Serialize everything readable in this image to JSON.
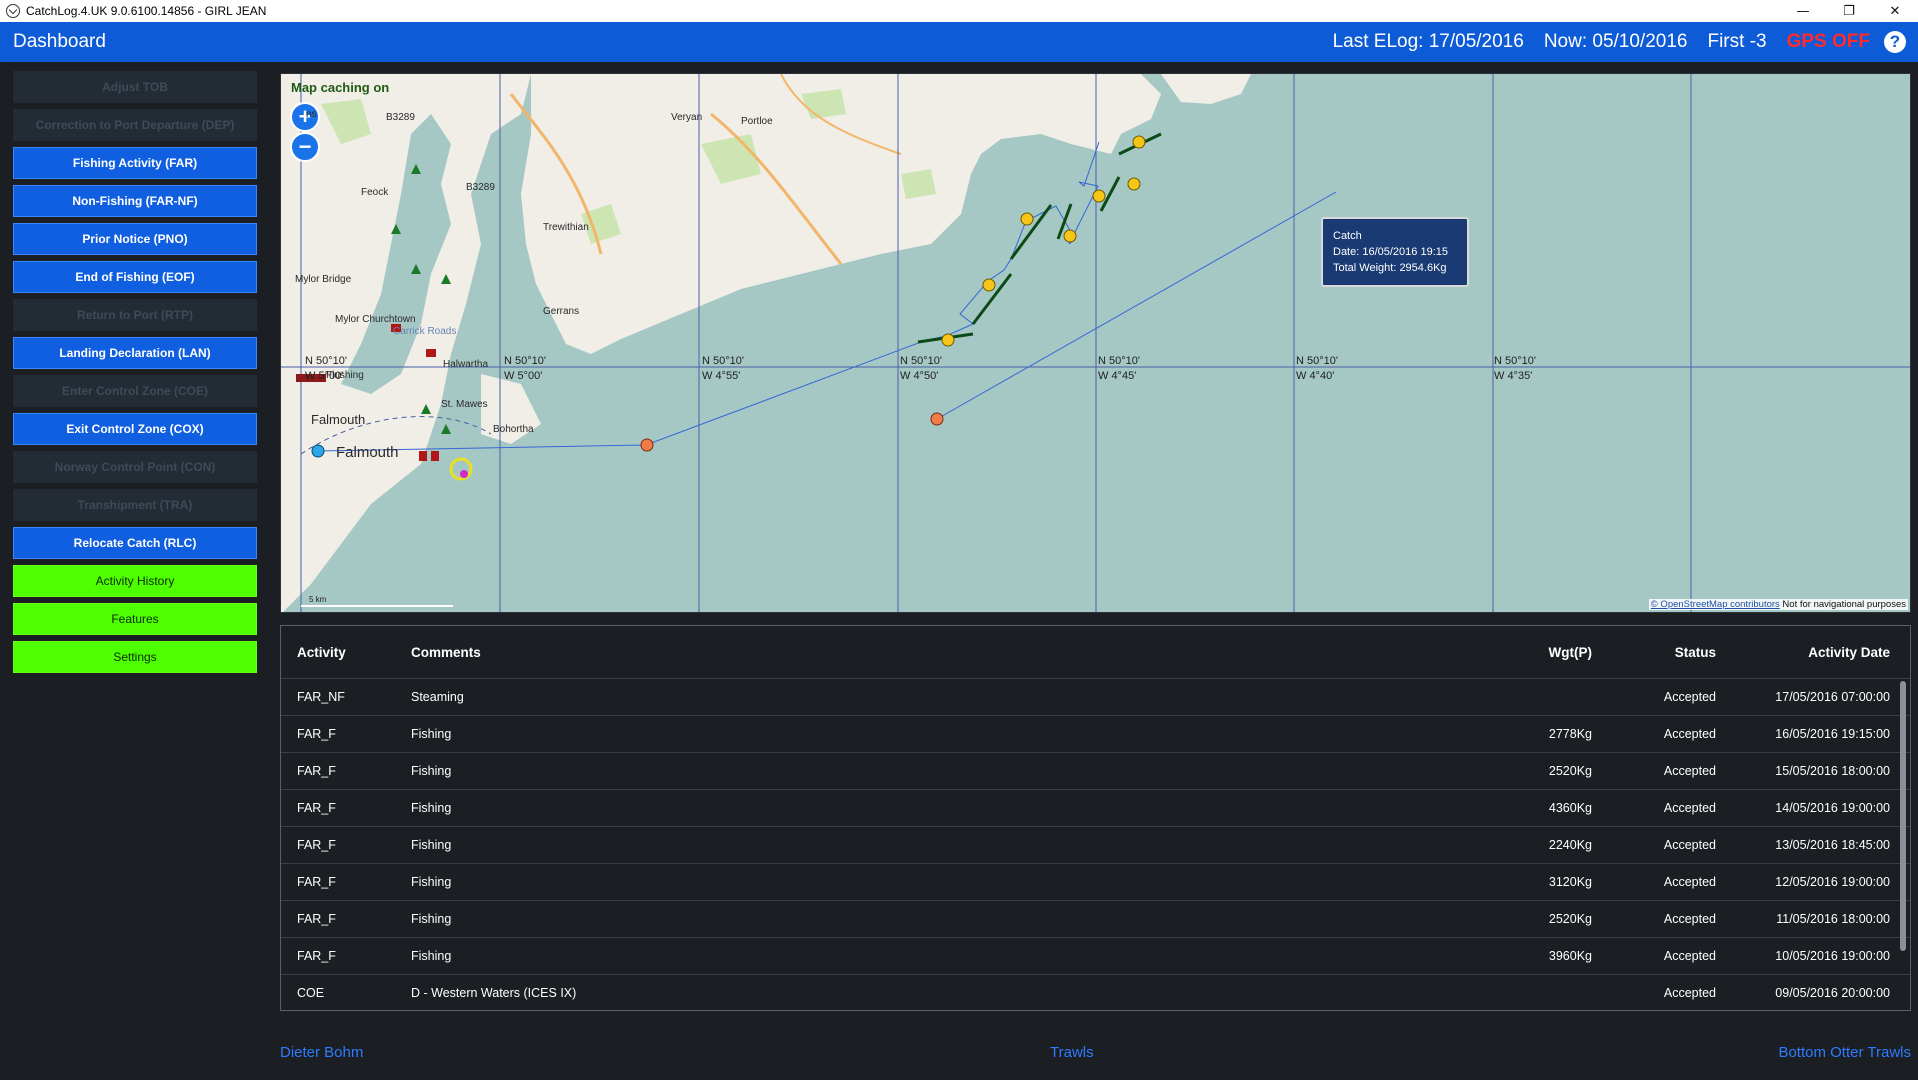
{
  "window": {
    "title": "CatchLog.4.UK 9.0.6100.14856  -  GIRL JEAN",
    "minimize": "—",
    "restore": "❐",
    "close": "✕"
  },
  "header": {
    "title": "Dashboard",
    "last_elog": "Last ELog: 17/05/2016",
    "now": "Now: 05/10/2016",
    "first": "First -3",
    "gps": "GPS OFF",
    "help": "?"
  },
  "sidebar": {
    "items": [
      {
        "label": "Adjust TOB",
        "state": "disabled"
      },
      {
        "label": "Correction to Port Departure (DEP)",
        "state": "disabled"
      },
      {
        "label": "Fishing Activity (FAR)",
        "state": "active"
      },
      {
        "label": "Non-Fishing (FAR-NF)",
        "state": "active"
      },
      {
        "label": "Prior Notice (PNO)",
        "state": "active"
      },
      {
        "label": "End of Fishing (EOF)",
        "state": "active"
      },
      {
        "label": "Return to Port (RTP)",
        "state": "disabled"
      },
      {
        "label": "Landing Declaration (LAN)",
        "state": "active"
      },
      {
        "label": "Enter Control Zone (COE)",
        "state": "disabled"
      },
      {
        "label": "Exit Control Zone (COX)",
        "state": "active"
      },
      {
        "label": "Norway Control Point (CON)",
        "state": "disabled"
      },
      {
        "label": "Transhipment (TRA)",
        "state": "disabled"
      },
      {
        "label": "Relocate Catch (RLC)",
        "state": "active"
      },
      {
        "label": "Activity History",
        "state": "green"
      },
      {
        "label": "Features",
        "state": "green"
      },
      {
        "label": "Settings",
        "state": "green"
      }
    ]
  },
  "map": {
    "caching_label": "Map caching on",
    "zoom_in": "+",
    "zoom_out": "−",
    "grid_labels": [
      {
        "lat": "N 50°10'",
        "lon": "W 5°00'"
      },
      {
        "lat": "N 50°10'",
        "lon": "W 4°55'"
      },
      {
        "lat": "N 50°10'",
        "lon": "W 4°50'"
      },
      {
        "lat": "N 50°10'",
        "lon": "W 4°45'"
      },
      {
        "lat": "N 50°10'",
        "lon": "W 4°40'"
      },
      {
        "lat": "N 50°10'",
        "lon": "W 4°35'"
      }
    ],
    "places": [
      "B3289",
      "B3289",
      "Veryan",
      "Portloe",
      "Feock",
      "Trewithian",
      "Mylor Bridge",
      "Mylor Churchtown",
      "Carrick Roads",
      "Gerrans",
      "Halwartha",
      "St. Mawes",
      "Bohortha",
      "Falmouth",
      "Falmouth",
      "Flushing",
      "ns"
    ],
    "tooltip": {
      "title": "Catch",
      "date": "Date: 16/05/2016 19:15",
      "weight": "Total Weight: 2954.6Kg"
    },
    "scale": "5 km",
    "attribution_link": "© OpenStreetMap contributors",
    "attribution_note": " Not for navigational purposes",
    "colors": {
      "sea": "#a6c8c4",
      "land": "#f1eee8",
      "track": "#2a56c7",
      "trawl": "#0b4a16",
      "catch": "#f5c518",
      "port": "#f07c4a",
      "start": "#2ca7e8"
    }
  },
  "table": {
    "headers": {
      "activity": "Activity",
      "comments": "Comments",
      "wgt": "Wgt(P)",
      "status": "Status",
      "date": "Activity Date"
    },
    "rows": [
      {
        "activity": "FAR_NF",
        "comments": "Steaming",
        "wgt": "",
        "status": "Accepted",
        "date": "17/05/2016 07:00:00"
      },
      {
        "activity": "FAR_F",
        "comments": "Fishing",
        "wgt": "2778Kg",
        "status": "Accepted",
        "date": "16/05/2016 19:15:00"
      },
      {
        "activity": "FAR_F",
        "comments": "Fishing",
        "wgt": "2520Kg",
        "status": "Accepted",
        "date": "15/05/2016 18:00:00"
      },
      {
        "activity": "FAR_F",
        "comments": "Fishing",
        "wgt": "4360Kg",
        "status": "Accepted",
        "date": "14/05/2016 19:00:00"
      },
      {
        "activity": "FAR_F",
        "comments": "Fishing",
        "wgt": "2240Kg",
        "status": "Accepted",
        "date": "13/05/2016 18:45:00"
      },
      {
        "activity": "FAR_F",
        "comments": "Fishing",
        "wgt": "3120Kg",
        "status": "Accepted",
        "date": "12/05/2016 19:00:00"
      },
      {
        "activity": "FAR_F",
        "comments": "Fishing",
        "wgt": "2520Kg",
        "status": "Accepted",
        "date": "11/05/2016 18:00:00"
      },
      {
        "activity": "FAR_F",
        "comments": "Fishing",
        "wgt": "3960Kg",
        "status": "Accepted",
        "date": "10/05/2016 19:00:00"
      },
      {
        "activity": "COE",
        "comments": "D - Western Waters (ICES IX)",
        "wgt": "",
        "status": "Accepted",
        "date": "09/05/2016 20:00:00"
      }
    ]
  },
  "footer": {
    "left": "Dieter Bohm",
    "center": "Trawls",
    "right": "Bottom Otter Trawls"
  }
}
